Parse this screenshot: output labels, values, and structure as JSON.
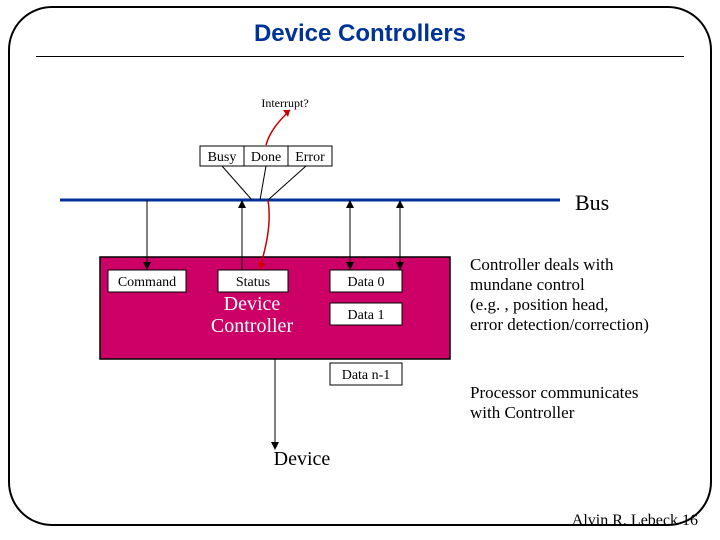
{
  "title": "Device Controllers",
  "interrupt_label": "Interrupt?",
  "status_flags": {
    "busy": "Busy",
    "done": "Done",
    "error": "Error"
  },
  "bus_label": "Bus",
  "controller": {
    "command": "Command",
    "status": "Status",
    "name_line1": "Device",
    "name_line2": "Controller",
    "data0": "Data 0",
    "data1": "Data 1",
    "datan": "Data n-1"
  },
  "device_label": "Device",
  "notes": {
    "l1": "Controller deals with",
    "l2": "mundane control",
    "l3": "(e.g. , position head,",
    "l4": "  error detection/correction)",
    "l5": "Processor communicates",
    "l6": "with Controller"
  },
  "footer": "Alvin R. Lebeck 16"
}
